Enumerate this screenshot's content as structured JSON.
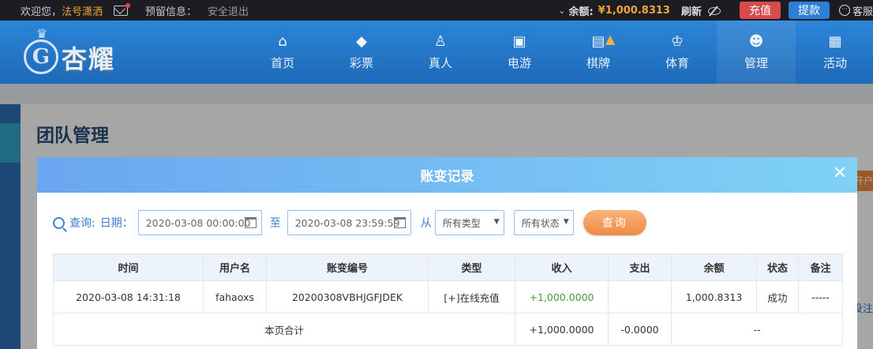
{
  "topbar": {
    "welcome_prefix": "欢迎您，",
    "username": "法号潇洒",
    "reserve_info": "预留信息：",
    "logout": "安全退出",
    "balance_label": "余额:",
    "balance_value": "¥1,000.8313",
    "refresh": "刷新",
    "recharge": "充值",
    "withdraw": "提款",
    "service": "客服"
  },
  "brand": {
    "name": "杏耀",
    "crest_letter": "G"
  },
  "nav": {
    "items": [
      {
        "label": "首页",
        "icon": "home-icon"
      },
      {
        "label": "彩票",
        "icon": "ticket-icon"
      },
      {
        "label": "真人",
        "icon": "dealer-icon"
      },
      {
        "label": "电游",
        "icon": "arcade-icon"
      },
      {
        "label": "棋牌",
        "icon": "cards-icon"
      },
      {
        "label": "体育",
        "icon": "trophy-icon"
      },
      {
        "label": "管理",
        "icon": "users-icon"
      },
      {
        "label": "活动",
        "icon": "gift-icon"
      }
    ]
  },
  "page": {
    "title": "团队管理",
    "right_tab": "开户",
    "right_link": "投注"
  },
  "modal": {
    "title": "账变记录",
    "filter": {
      "query_label": "查询:",
      "date_label": "日期：",
      "start_date": "2020-03-08 00:00:00",
      "to_label": "至",
      "end_date": "2020-03-08 23:59:59",
      "from_label": "从",
      "type_select": "所有类型",
      "status_select": "所有状态",
      "query_button": "查询"
    },
    "table": {
      "headers": [
        "时间",
        "用户名",
        "账变编号",
        "类型",
        "收入",
        "支出",
        "余额",
        "状态",
        "备注"
      ],
      "rows": [
        [
          "2020-03-08 14:31:18",
          "fahaoxs",
          "20200308VBHJGFJDEK",
          "[+]在线充值",
          "+1,000.0000",
          "",
          "1,000.8313",
          "成功",
          "-----"
        ]
      ],
      "summary": {
        "label": "本页合计",
        "income": "+1,000.0000",
        "expense": "-0.0000",
        "balance": "--"
      }
    }
  },
  "colors": {
    "accent": "#3d7fcf",
    "income": "#4a9a3a",
    "username": "#f2a33a",
    "recharge_btn": "#d84b4b",
    "withdraw_btn": "#2c7fd6",
    "query_btn": "#f08a43"
  }
}
